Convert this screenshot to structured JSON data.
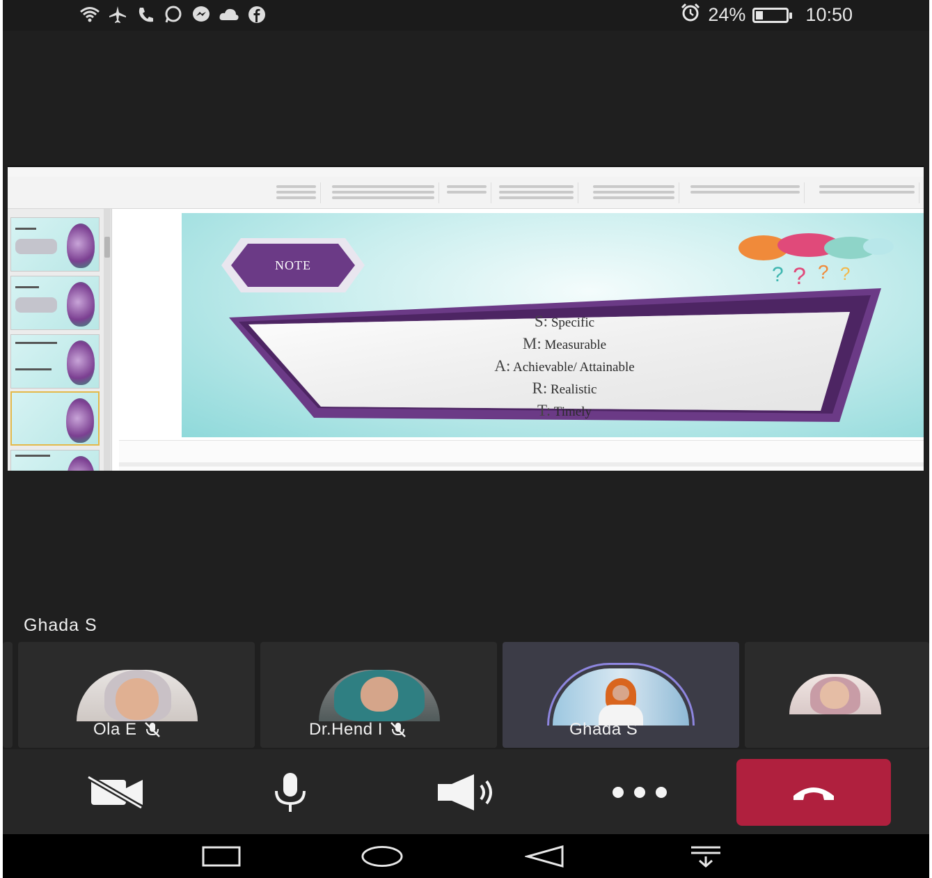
{
  "status_bar": {
    "icons": [
      "wifi-icon",
      "airplane-icon",
      "phone-icon",
      "whatsapp-icon",
      "messenger-icon",
      "cloud-icon",
      "facebook-icon"
    ],
    "alarm_icon": "alarm-icon",
    "battery_text": "24%",
    "battery_level": 0.24,
    "time": "10:50"
  },
  "shared_screen": {
    "slide": {
      "badge": "NOTE",
      "items": [
        {
          "letter": "S:",
          "text": "Specific"
        },
        {
          "letter": "M:",
          "text": "Measurable"
        },
        {
          "letter": "A:",
          "text": "Achievable/ Attainable"
        },
        {
          "letter": "R:",
          "text": "Realistic"
        },
        {
          "letter": "T:",
          "text": "Timely"
        }
      ]
    }
  },
  "speaker": {
    "name": "Ghada S"
  },
  "participants": [
    {
      "name": "Ola E",
      "muted": true
    },
    {
      "name": "Dr.Hend I",
      "muted": true
    },
    {
      "name": "Ghada S",
      "muted": false,
      "active": true
    },
    {
      "name": "",
      "muted": false
    }
  ],
  "controls": {
    "icons": [
      "video-off-icon",
      "microphone-icon",
      "speaker-icon",
      "more-icon",
      "hang-up-icon"
    ]
  },
  "navbar": {
    "icons": [
      "recent-apps-icon",
      "home-icon",
      "back-icon",
      "notification-drawer-icon"
    ]
  },
  "colors": {
    "background": "#1f1f1f",
    "end_call": "#b0203e",
    "active_tile": "#3c3c47",
    "slide_accent": "#6b3a86"
  }
}
